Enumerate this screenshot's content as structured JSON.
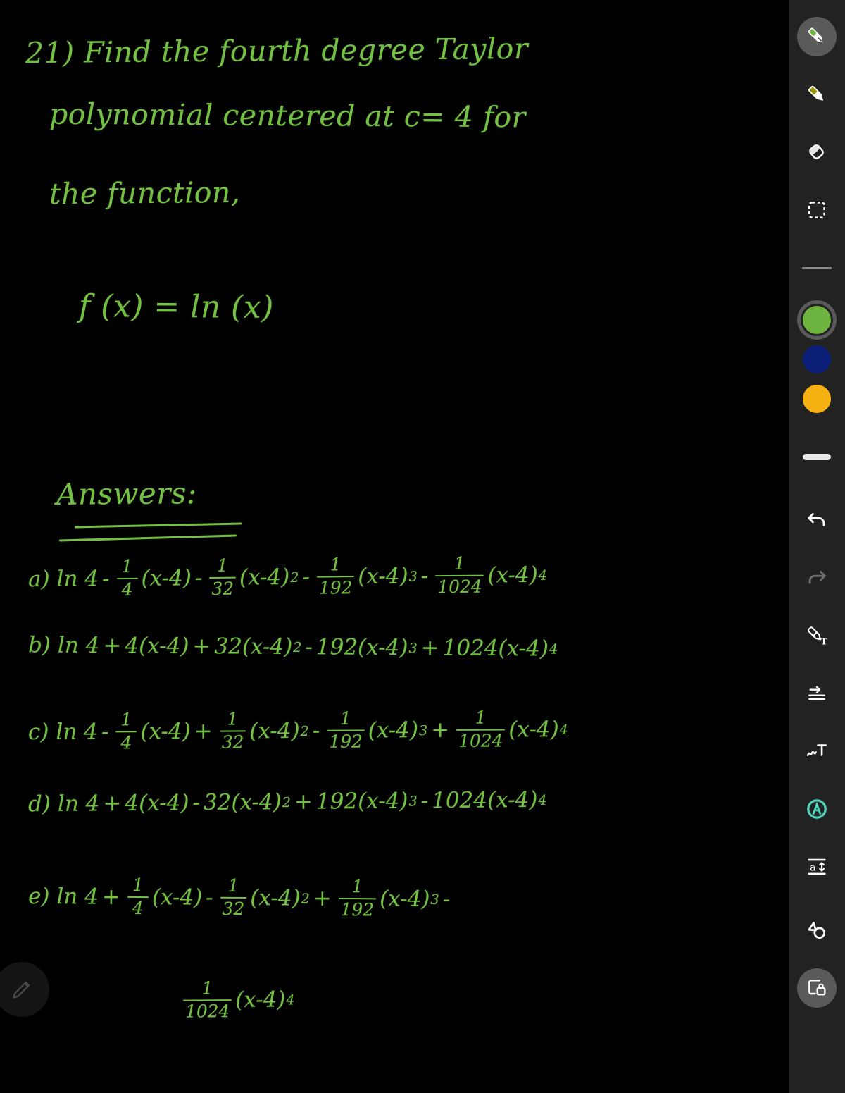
{
  "app": {
    "background_color": "#000000",
    "ink_color": "#74c044",
    "toolbar_color": "#222222"
  },
  "note": {
    "question_number": "21)",
    "prompt_line_1": "21) Find the fourth degree Taylor",
    "prompt_line_2": "polynomial centered at c= 4 for",
    "prompt_line_3": "the function,",
    "function": "f (x) = ln (x)",
    "answers_heading": "Answers:",
    "choices": [
      {
        "label": "a)",
        "text": "ln 4 - 1/4 (x-4) - 1/32 (x-4)^2 - 1/192 (x-4)^3 - 1/1024 (x-4)^4",
        "lead": "ln 4",
        "terms": [
          {
            "op": "-",
            "frac": {
              "num": "1",
              "den": "4"
            },
            "coef": "",
            "base": "(x-4)",
            "power": ""
          },
          {
            "op": "-",
            "frac": {
              "num": "1",
              "den": "32"
            },
            "coef": "",
            "base": "(x-4)",
            "power": "2"
          },
          {
            "op": "-",
            "frac": {
              "num": "1",
              "den": "192"
            },
            "coef": "",
            "base": "(x-4)",
            "power": "3"
          },
          {
            "op": "-",
            "frac": {
              "num": "1",
              "den": "1024"
            },
            "coef": "",
            "base": "(x-4)",
            "power": "4"
          }
        ]
      },
      {
        "label": "b)",
        "text": "ln 4 + 4(x-4) + 32(x-4)^2 - 192(x-4)^3 + 1024(x-4)^4",
        "lead": "ln 4",
        "terms": [
          {
            "op": "+",
            "frac": null,
            "coef": "4",
            "base": "(x-4)",
            "power": ""
          },
          {
            "op": "+",
            "frac": null,
            "coef": "32",
            "base": "(x-4)",
            "power": "2"
          },
          {
            "op": "-",
            "frac": null,
            "coef": "192",
            "base": "(x-4)",
            "power": "3"
          },
          {
            "op": "+",
            "frac": null,
            "coef": "1024",
            "base": "(x-4)",
            "power": "4"
          }
        ]
      },
      {
        "label": "c)",
        "text": "ln 4 - 1/4 (x-4) + 1/32 (x-4)^2 - 1/192 (x-4)^3 + 1/1024 (x-4)^4",
        "lead": "ln 4",
        "terms": [
          {
            "op": "-",
            "frac": {
              "num": "1",
              "den": "4"
            },
            "coef": "",
            "base": "(x-4)",
            "power": ""
          },
          {
            "op": "+",
            "frac": {
              "num": "1",
              "den": "32"
            },
            "coef": "",
            "base": "(x-4)",
            "power": "2"
          },
          {
            "op": "-",
            "frac": {
              "num": "1",
              "den": "192"
            },
            "coef": "",
            "base": "(x-4)",
            "power": "3"
          },
          {
            "op": "+",
            "frac": {
              "num": "1",
              "den": "1024"
            },
            "coef": "",
            "base": "(x-4)",
            "power": "4"
          }
        ]
      },
      {
        "label": "d)",
        "text": "ln 4 + 4(x-4) - 32(x-4)^2 + 192(x-4)^3 - 1024(x-4)^4",
        "lead": "ln 4",
        "terms": [
          {
            "op": "+",
            "frac": null,
            "coef": "4",
            "base": "(x-4)",
            "power": ""
          },
          {
            "op": "-",
            "frac": null,
            "coef": "32",
            "base": "(x-4)",
            "power": "2"
          },
          {
            "op": "+",
            "frac": null,
            "coef": "192",
            "base": "(x-4)",
            "power": "3"
          },
          {
            "op": "-",
            "frac": null,
            "coef": "1024",
            "base": "(x-4)",
            "power": "4"
          }
        ]
      },
      {
        "label": "e)",
        "text": "ln 4 + 1/4 (x-4) - 1/32 (x-4)^2 + 1/192 (x-4)^3 - 1/1024 (x-4)^4",
        "lead": "ln 4",
        "terms": [
          {
            "op": "+",
            "frac": {
              "num": "1",
              "den": "4"
            },
            "coef": "",
            "base": "(x-4)",
            "power": ""
          },
          {
            "op": "-",
            "frac": {
              "num": "1",
              "den": "32"
            },
            "coef": "",
            "base": "(x-4)",
            "power": "2"
          },
          {
            "op": "+",
            "frac": {
              "num": "1",
              "den": "192"
            },
            "coef": "",
            "base": "(x-4)",
            "power": "3"
          }
        ],
        "wrapped_term": {
          "op": "-",
          "frac": {
            "num": "1",
            "den": "1024"
          },
          "base": "(x-4)",
          "power": "4"
        }
      }
    ]
  },
  "toolbar": {
    "items": [
      {
        "icon": "pen-icon",
        "selected": true
      },
      {
        "icon": "highlighter-icon",
        "selected": false
      },
      {
        "icon": "eraser-icon",
        "selected": false
      },
      {
        "icon": "lasso-select-icon",
        "selected": false
      },
      {
        "icon": "divider",
        "selected": false
      },
      {
        "icon": "color-swatch-green",
        "selected": true,
        "color": "#6cb33f"
      },
      {
        "icon": "color-swatch-blue",
        "selected": false,
        "color": "#0b1f78"
      },
      {
        "icon": "color-swatch-amber",
        "selected": false,
        "color": "#f5b212"
      },
      {
        "icon": "stroke-thickness-bar",
        "selected": false
      },
      {
        "icon": "undo-icon",
        "selected": false,
        "state": "enabled"
      },
      {
        "icon": "redo-icon",
        "selected": false,
        "state": "disabled"
      },
      {
        "icon": "pen-to-text-icon",
        "selected": false
      },
      {
        "icon": "insert-space-icon",
        "selected": false
      },
      {
        "icon": "scribble-text-icon",
        "selected": false
      },
      {
        "icon": "scribble-a-icon",
        "selected": false,
        "color": "#4fd6b8"
      },
      {
        "icon": "text-size-icon",
        "selected": false
      },
      {
        "icon": "shape-select-icon",
        "selected": false
      },
      {
        "icon": "lock-page-icon",
        "selected": false
      }
    ],
    "text_size_label": "a"
  },
  "fab": {
    "icon": "pencil-icon"
  }
}
